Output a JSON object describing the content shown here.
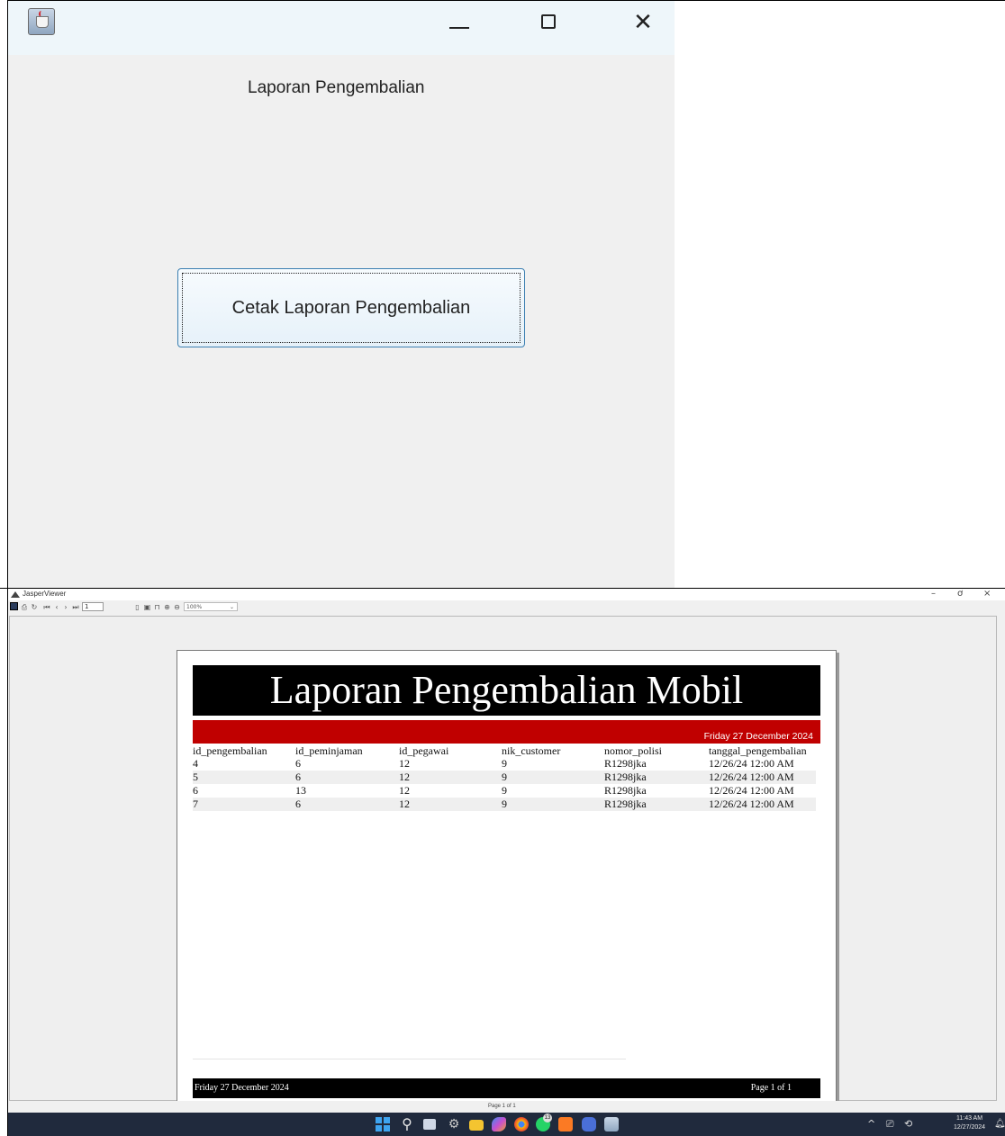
{
  "top_window": {
    "heading": "Laporan Pengembalian",
    "button_label": "Cetak Laporan Pengembalian",
    "controls": {
      "minimize": "—",
      "close": "✕"
    }
  },
  "jasper_viewer": {
    "title": "JasperViewer",
    "window_controls": {
      "minimize": "–",
      "maximize": "ơ",
      "close": "×"
    },
    "toolbar": {
      "page_input": "1",
      "zoom_value": "100%"
    },
    "status": "Page 1 of 1"
  },
  "report": {
    "title": "Laporan Pengembalian Mobil",
    "header_date": "Friday 27 December 2024",
    "columns": [
      "id_pengembalian",
      "id_peminjaman",
      "id_pegawai",
      "nik_customer",
      "nomor_polisi",
      "tanggal_pengembalian"
    ],
    "rows": [
      [
        "4",
        "6",
        "12",
        "9",
        "R1298jka",
        "12/26/24 12:00 AM"
      ],
      [
        "5",
        "6",
        "12",
        "9",
        "R1298jka",
        "12/26/24 12:00 AM"
      ],
      [
        "6",
        "13",
        "12",
        "9",
        "R1298jka",
        "12/26/24 12:00 AM"
      ],
      [
        "7",
        "6",
        "12",
        "9",
        "R1298jka",
        "12/26/24 12:00 AM"
      ]
    ],
    "footer_date": "Friday 27 December 2024",
    "footer_page": "Page 1 of 1"
  },
  "taskbar": {
    "time": "11:43 AM",
    "date": "12/27/2024",
    "whatsapp_badge": "13",
    "tray_icons": "^ ⎚ ⟲"
  }
}
